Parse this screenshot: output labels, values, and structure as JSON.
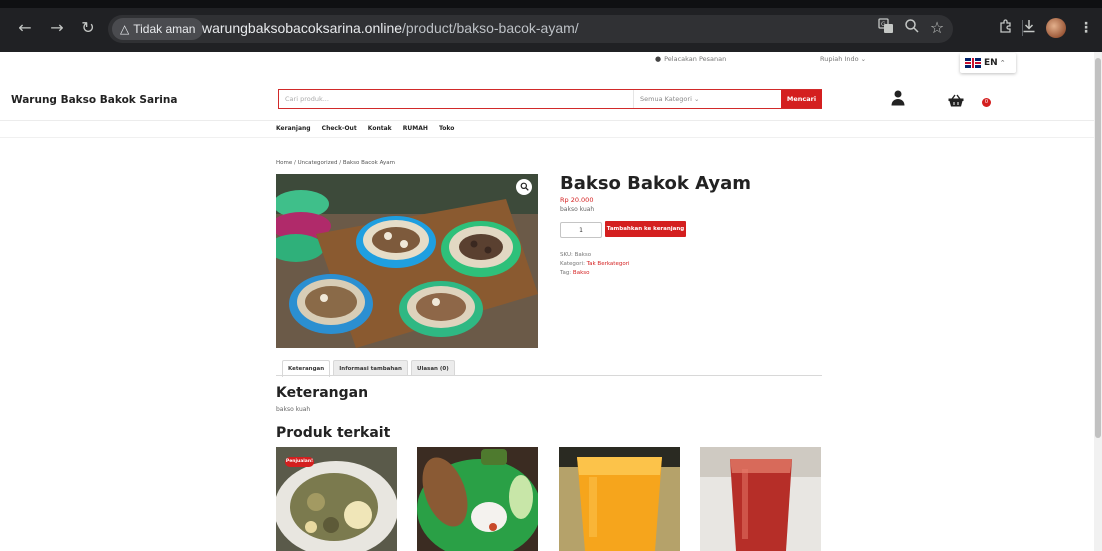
{
  "browser": {
    "back_icon": "arrow-left-icon",
    "forward_icon": "arrow-right-icon",
    "reload_icon": "reload-icon",
    "security_chip_label": "Tidak aman",
    "url_domain": "warungbaksobacoksarina.online",
    "url_path": "/product/bakso-bacok-ayam/",
    "icons": [
      "translate-icon",
      "zoom-icon",
      "bookmark-star-icon",
      "extensions-icon",
      "download-icon",
      "profile-avatar",
      "menu-icon"
    ]
  },
  "topbar": {
    "location_label": "Pelacakan Pesanan",
    "currency_label": "Rupiah Indo",
    "language_label": "EN"
  },
  "header": {
    "site_title": "Warung Bakso Bakok Sarina",
    "search_placeholder": "Cari produk...",
    "category_label": "Semua Kategori",
    "search_button": "Mencari",
    "cart_count": "0"
  },
  "nav": {
    "items": [
      "Keranjang",
      "Check-Out",
      "Kontak",
      "RUMAH",
      "Toko"
    ]
  },
  "breadcrumb": {
    "home": "Home",
    "separator": "/",
    "category": "Uncategorized",
    "current": "Bakso Bacok Ayam"
  },
  "product": {
    "title": "Bakso Bakok Ayam",
    "price": "Rp 20.000",
    "short_description": "bakso kuah",
    "quantity": "1",
    "add_to_cart_label": "Tambahkan ke keranjang",
    "sku_label": "SKU:",
    "sku_value": "Bakso",
    "category_label": "Kategori:",
    "category_value": "Tak Berkategori",
    "tag_label": "Tag:",
    "tag_value": "Bakso"
  },
  "tabs": {
    "items": [
      "Keterangan",
      "Informasi tambahan",
      "Ulasan (0)"
    ],
    "active_index": 0
  },
  "description": {
    "title": "Keterangan",
    "text": "bakso kuah"
  },
  "related": {
    "title": "Produk terkait",
    "sale_badge": "Penjualan!"
  },
  "colors": {
    "accent": "#d41f1f",
    "chrome_bg": "#202124"
  }
}
